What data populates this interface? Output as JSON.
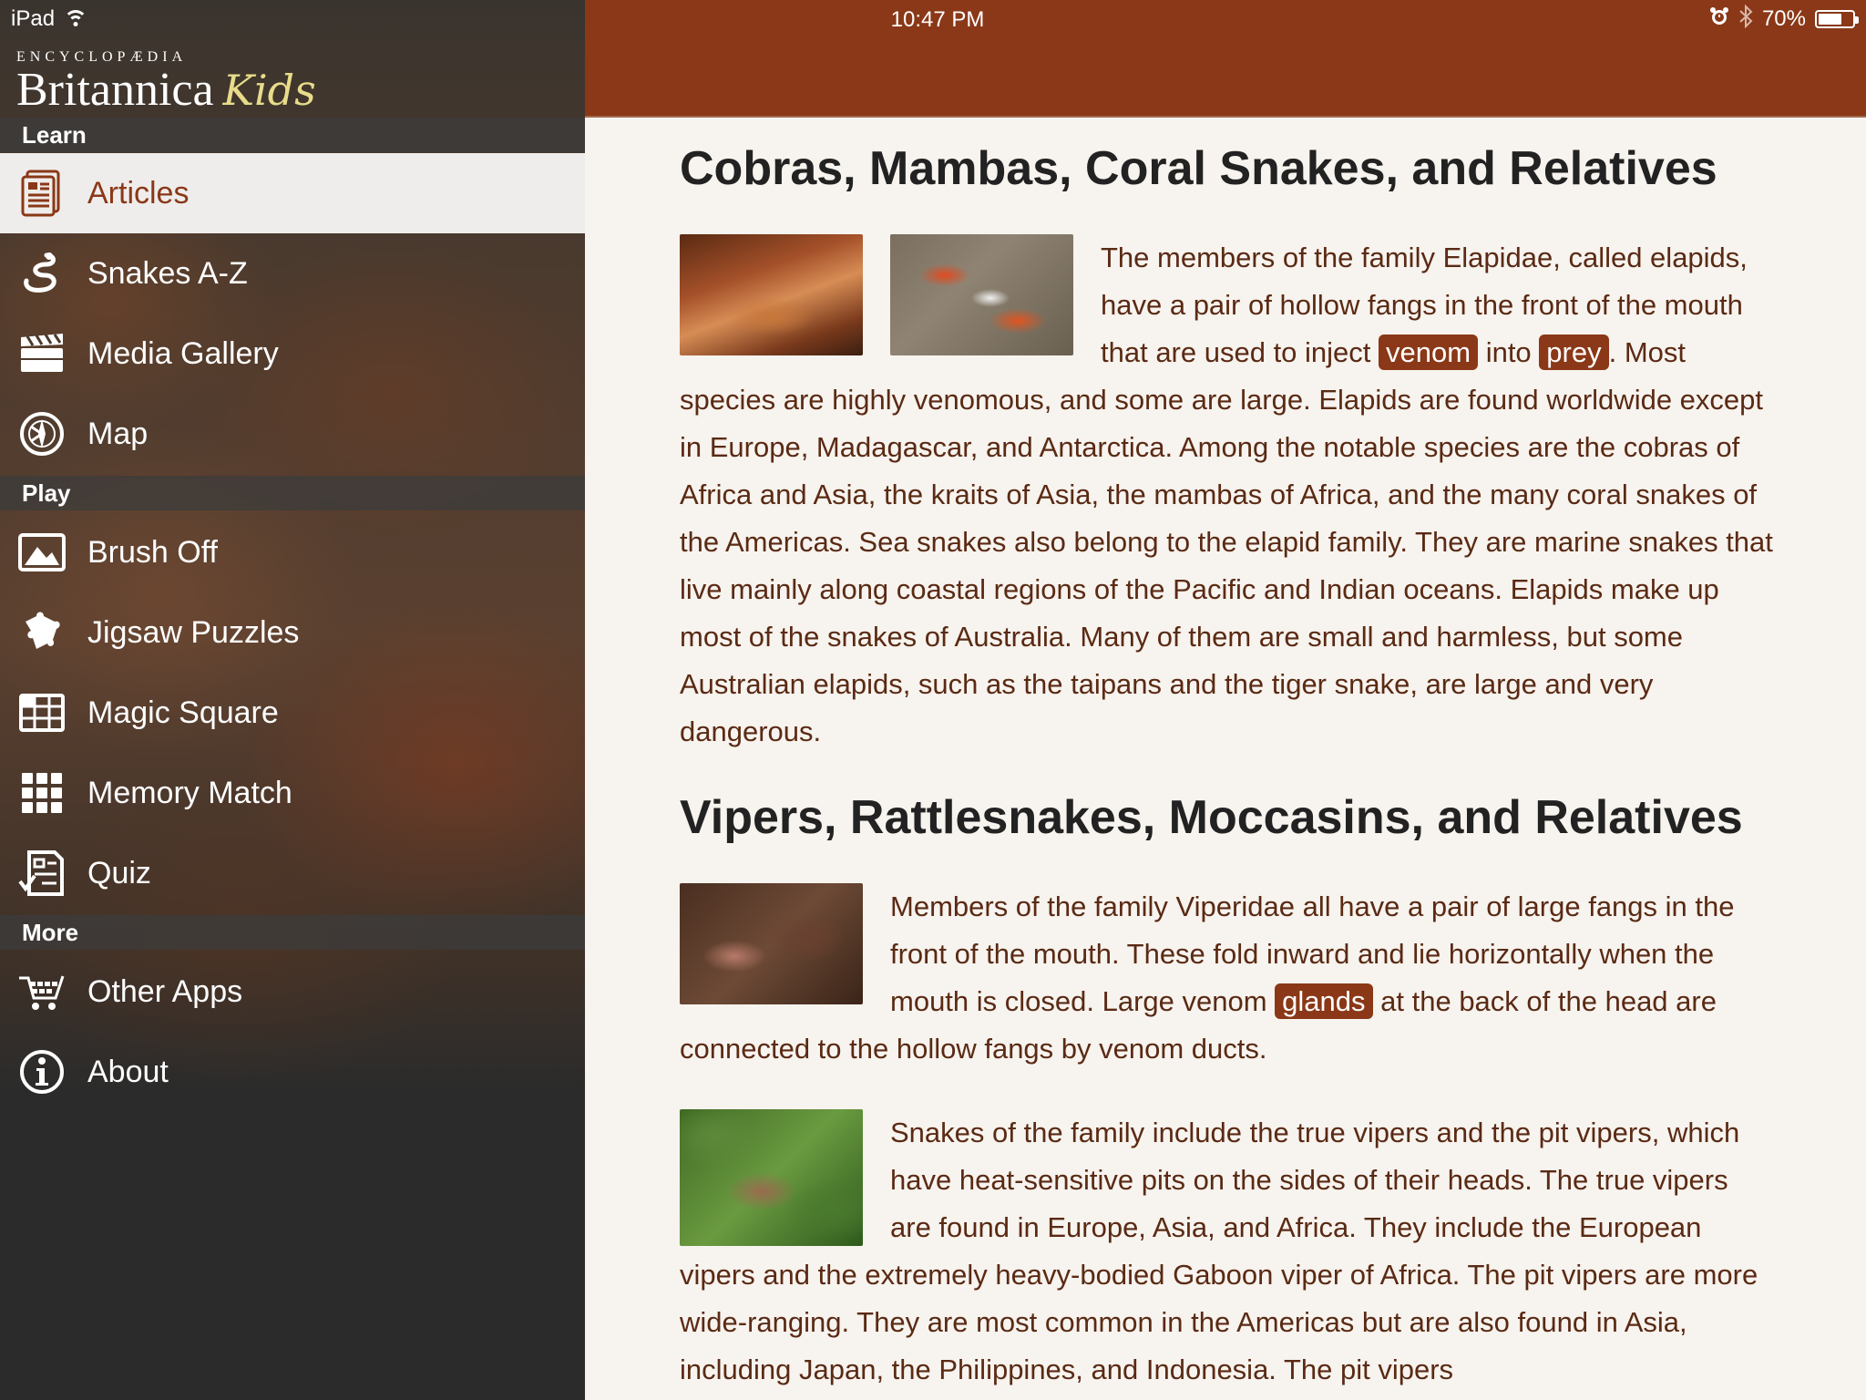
{
  "status_bar": {
    "device": "iPad",
    "time": "10:47 PM",
    "battery": "70%",
    "battery_level": 0.7
  },
  "logo": {
    "small": "ENCYCLOPÆDIA",
    "main": "Britannica",
    "kids": "Kids"
  },
  "sidebar": {
    "sections": [
      {
        "title": "Learn",
        "items": [
          {
            "label": "Articles",
            "icon": "articles-icon",
            "active": true
          },
          {
            "label": "Snakes A-Z",
            "icon": "snake-icon"
          },
          {
            "label": "Media Gallery",
            "icon": "clapperboard-icon"
          },
          {
            "label": "Map",
            "icon": "compass-icon"
          }
        ]
      },
      {
        "title": "Play",
        "items": [
          {
            "label": "Brush Off",
            "icon": "picture-icon"
          },
          {
            "label": "Jigsaw Puzzles",
            "icon": "puzzle-icon"
          },
          {
            "label": "Magic Square",
            "icon": "grid-icon"
          },
          {
            "label": "Memory Match",
            "icon": "tiles-icon"
          },
          {
            "label": "Quiz",
            "icon": "quiz-icon"
          }
        ]
      },
      {
        "title": "More",
        "items": [
          {
            "label": "Other Apps",
            "icon": "cart-icon"
          },
          {
            "label": "About",
            "icon": "info-icon"
          }
        ]
      }
    ]
  },
  "colors": {
    "accent": "#8a3817",
    "text": "#5a2a14",
    "heading": "#222222"
  },
  "article": {
    "section1": {
      "title": "Cobras, Mambas, Coral Snakes, and Relatives",
      "p1_a": "The members of the family Elapidae, called elapids, have a pair of hollow fangs in the front of the mouth that are used to inject ",
      "term1": "venom",
      "p1_b": " into ",
      "term2": "prey",
      "p1_c": ". Most species are highly venomous, and some are large. Elapids are found worldwide except in Europe, Madagascar, and Antarctica. Among the notable species are the cobras of Africa and Asia, the kraits of Asia, the mambas of Africa, and the many coral snakes of the Americas. Sea snakes also belong to the elapid family. They are marine snakes that live mainly along coastal regions of the Pacific and Indian oceans. Elapids make up most of the snakes of Australia. Many of them are small and harmless, but some Australian elapids, such as the taipans and the tiger snake, are large and very dangerous."
    },
    "section2": {
      "title": "Vipers, Rattlesnakes, Moccasins, and Relatives",
      "p1_a": "Members of the family Viperidae all have a pair of large fangs in the front of the mouth. These fold inward and lie horizontally when the mouth is closed. Large venom ",
      "term1": "glands",
      "p1_b": " at the back of the head are connected to the hollow fangs by venom ducts.",
      "p2": "Snakes of the family include the true vipers and the pit vipers, which have heat-sensitive pits on the sides of their heads. The true vipers are found in Europe, Asia, and Africa. They include the European vipers and the extremely heavy-bodied Gaboon viper of Africa. The pit vipers are more wide-ranging. They are most common in the Americas but are also found in Asia, including Japan, the Philippines, and Indonesia. The pit vipers"
    }
  }
}
